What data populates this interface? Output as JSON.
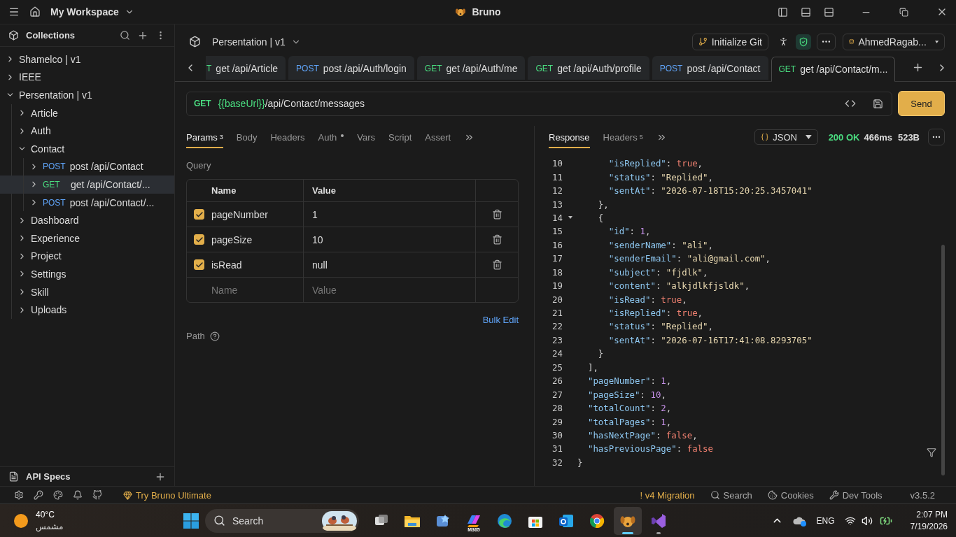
{
  "titlebar": {
    "workspace": "My Workspace",
    "app_title": "Bruno"
  },
  "sidebar": {
    "title": "Collections",
    "tree": [
      {
        "label": "Shamelco | v1",
        "expanded": false,
        "selected": false
      },
      {
        "label": "IEEE",
        "expanded": false,
        "selected": false
      },
      {
        "label": "Persentation | v1",
        "expanded": true,
        "selected": false,
        "children": [
          {
            "label": "Article",
            "expanded": false,
            "selected": false
          },
          {
            "label": "Auth",
            "expanded": false,
            "selected": false
          },
          {
            "label": "Contact",
            "expanded": true,
            "selected": false,
            "children": [
              {
                "method": "POST",
                "kind": "post",
                "label": "post /api/Contact",
                "expanded": false,
                "selected": false
              },
              {
                "method": "GET",
                "kind": "get",
                "label": "get /api/Contact/...",
                "expanded": false,
                "selected": true
              },
              {
                "method": "POST",
                "kind": "post",
                "label": "post /api/Contact/...",
                "expanded": false,
                "selected": false
              }
            ]
          },
          {
            "label": "Dashboard",
            "expanded": false,
            "selected": false
          },
          {
            "label": "Experience",
            "expanded": false,
            "selected": false
          },
          {
            "label": "Project",
            "expanded": false,
            "selected": false
          },
          {
            "label": "Settings",
            "expanded": false,
            "selected": false
          },
          {
            "label": "Skill",
            "expanded": false,
            "selected": false
          },
          {
            "label": "Uploads",
            "expanded": false,
            "selected": false
          }
        ]
      }
    ],
    "footer": "API Specs"
  },
  "collection_header": {
    "title": "Persentation | v1",
    "git_button": "Initialize Git",
    "environment": "AhmedRagab..."
  },
  "request_tabs": [
    {
      "method": "T",
      "kind": "get",
      "label": "get /api/Article",
      "selected": false
    },
    {
      "method": "POST",
      "kind": "post",
      "label": "post /api/Auth/login",
      "selected": false
    },
    {
      "method": "GET",
      "kind": "get",
      "label": "get /api/Auth/me",
      "selected": false
    },
    {
      "method": "GET",
      "kind": "get",
      "label": "get /api/Auth/profile",
      "selected": false
    },
    {
      "method": "POST",
      "kind": "post",
      "label": "post /api/Contact",
      "selected": false
    },
    {
      "method": "GET",
      "kind": "get",
      "label": "get /api/Contact/m...",
      "selected": true
    }
  ],
  "url_bar": {
    "method": "GET",
    "variable": "{{baseUrl}}",
    "path": "/api/Contact/messages",
    "send": "Send"
  },
  "request_pane": {
    "tabs": [
      {
        "label": "Params",
        "count": "3",
        "dot": false,
        "selected": true
      },
      {
        "label": "Body",
        "dot": false,
        "selected": false
      },
      {
        "label": "Headers",
        "dot": false,
        "selected": false
      },
      {
        "label": "Auth",
        "dot": true,
        "selected": false
      },
      {
        "label": "Vars",
        "dot": false,
        "selected": false
      },
      {
        "label": "Script",
        "dot": false,
        "selected": false
      },
      {
        "label": "Assert",
        "dot": false,
        "selected": false
      }
    ],
    "section": "Query",
    "columns": [
      "Name",
      "Value"
    ],
    "params": [
      {
        "name": "pageNumber",
        "value": "1",
        "checked": true
      },
      {
        "name": "pageSize",
        "value": "10",
        "checked": true
      },
      {
        "name": "isRead",
        "value": "null",
        "checked": true
      }
    ],
    "new_row": {
      "name_placeholder": "Name",
      "value_placeholder": "Value"
    },
    "bulk_edit": "Bulk Edit",
    "path_label": "Path"
  },
  "response_pane": {
    "tabs": [
      {
        "label": "Response",
        "selected": true
      },
      {
        "label": "Headers",
        "count": "5",
        "selected": false
      }
    ],
    "format": "JSON",
    "status": "200 OK",
    "time": "466ms",
    "size": "523B",
    "lines": [
      {
        "number": "10",
        "foldable": false,
        "tokens": [
          {
            "kind": "key",
            "text": "      \"isReplied\""
          },
          {
            "kind": "punct",
            "text": ": "
          },
          {
            "kind": "bool",
            "text": "true"
          },
          {
            "kind": "punct",
            "text": ","
          }
        ]
      },
      {
        "number": "11",
        "foldable": false,
        "tokens": [
          {
            "kind": "key",
            "text": "      \"status\""
          },
          {
            "kind": "punct",
            "text": ": "
          },
          {
            "kind": "string",
            "text": "\"Replied\""
          },
          {
            "kind": "punct",
            "text": ","
          }
        ]
      },
      {
        "number": "12",
        "foldable": false,
        "tokens": [
          {
            "kind": "key",
            "text": "      \"sentAt\""
          },
          {
            "kind": "punct",
            "text": ": "
          },
          {
            "kind": "string",
            "text": "\"2026-07-18T15:20:25.3457041\""
          }
        ]
      },
      {
        "number": "13",
        "foldable": false,
        "tokens": [
          {
            "kind": "punct",
            "text": "    },"
          }
        ]
      },
      {
        "number": "14",
        "foldable": true,
        "tokens": [
          {
            "kind": "punct",
            "text": "    {"
          }
        ]
      },
      {
        "number": "15",
        "foldable": false,
        "tokens": [
          {
            "kind": "key",
            "text": "      \"id\""
          },
          {
            "kind": "punct",
            "text": ": "
          },
          {
            "kind": "number",
            "text": "1"
          },
          {
            "kind": "punct",
            "text": ","
          }
        ]
      },
      {
        "number": "16",
        "foldable": false,
        "tokens": [
          {
            "kind": "key",
            "text": "      \"senderName\""
          },
          {
            "kind": "punct",
            "text": ": "
          },
          {
            "kind": "string",
            "text": "\"ali\""
          },
          {
            "kind": "punct",
            "text": ","
          }
        ]
      },
      {
        "number": "17",
        "foldable": false,
        "tokens": [
          {
            "kind": "key",
            "text": "      \"senderEmail\""
          },
          {
            "kind": "punct",
            "text": ": "
          },
          {
            "kind": "string",
            "text": "\"ali@gmail.com\""
          },
          {
            "kind": "punct",
            "text": ","
          }
        ]
      },
      {
        "number": "18",
        "foldable": false,
        "tokens": [
          {
            "kind": "key",
            "text": "      \"subject\""
          },
          {
            "kind": "punct",
            "text": ": "
          },
          {
            "kind": "string",
            "text": "\"fjdlk\""
          },
          {
            "kind": "punct",
            "text": ","
          }
        ]
      },
      {
        "number": "19",
        "foldable": false,
        "tokens": [
          {
            "kind": "key",
            "text": "      \"content\""
          },
          {
            "kind": "punct",
            "text": ": "
          },
          {
            "kind": "string",
            "text": "\"alkjdlkfjsldk\""
          },
          {
            "kind": "punct",
            "text": ","
          }
        ]
      },
      {
        "number": "20",
        "foldable": false,
        "tokens": [
          {
            "kind": "key",
            "text": "      \"isRead\""
          },
          {
            "kind": "punct",
            "text": ": "
          },
          {
            "kind": "bool",
            "text": "true"
          },
          {
            "kind": "punct",
            "text": ","
          }
        ]
      },
      {
        "number": "21",
        "foldable": false,
        "tokens": [
          {
            "kind": "key",
            "text": "      \"isReplied\""
          },
          {
            "kind": "punct",
            "text": ": "
          },
          {
            "kind": "bool",
            "text": "true"
          },
          {
            "kind": "punct",
            "text": ","
          }
        ]
      },
      {
        "number": "22",
        "foldable": false,
        "tokens": [
          {
            "kind": "key",
            "text": "      \"status\""
          },
          {
            "kind": "punct",
            "text": ": "
          },
          {
            "kind": "string",
            "text": "\"Replied\""
          },
          {
            "kind": "punct",
            "text": ","
          }
        ]
      },
      {
        "number": "23",
        "foldable": false,
        "tokens": [
          {
            "kind": "key",
            "text": "      \"sentAt\""
          },
          {
            "kind": "punct",
            "text": ": "
          },
          {
            "kind": "string",
            "text": "\"2026-07-16T17:41:08.8293705\""
          }
        ]
      },
      {
        "number": "24",
        "foldable": false,
        "tokens": [
          {
            "kind": "punct",
            "text": "    }"
          }
        ]
      },
      {
        "number": "25",
        "foldable": false,
        "tokens": [
          {
            "kind": "punct",
            "text": "  ],"
          }
        ]
      },
      {
        "number": "26",
        "foldable": false,
        "tokens": [
          {
            "kind": "key",
            "text": "  \"pageNumber\""
          },
          {
            "kind": "punct",
            "text": ": "
          },
          {
            "kind": "number",
            "text": "1"
          },
          {
            "kind": "punct",
            "text": ","
          }
        ]
      },
      {
        "number": "27",
        "foldable": false,
        "tokens": [
          {
            "kind": "key",
            "text": "  \"pageSize\""
          },
          {
            "kind": "punct",
            "text": ": "
          },
          {
            "kind": "number",
            "text": "10"
          },
          {
            "kind": "punct",
            "text": ","
          }
        ]
      },
      {
        "number": "28",
        "foldable": false,
        "tokens": [
          {
            "kind": "key",
            "text": "  \"totalCount\""
          },
          {
            "kind": "punct",
            "text": ": "
          },
          {
            "kind": "number",
            "text": "2"
          },
          {
            "kind": "punct",
            "text": ","
          }
        ]
      },
      {
        "number": "29",
        "foldable": false,
        "tokens": [
          {
            "kind": "key",
            "text": "  \"totalPages\""
          },
          {
            "kind": "punct",
            "text": ": "
          },
          {
            "kind": "number",
            "text": "1"
          },
          {
            "kind": "punct",
            "text": ","
          }
        ]
      },
      {
        "number": "30",
        "foldable": false,
        "tokens": [
          {
            "kind": "key",
            "text": "  \"hasNextPage\""
          },
          {
            "kind": "punct",
            "text": ": "
          },
          {
            "kind": "bool",
            "text": "false"
          },
          {
            "kind": "punct",
            "text": ","
          }
        ]
      },
      {
        "number": "31",
        "foldable": false,
        "tokens": [
          {
            "kind": "key",
            "text": "  \"hasPreviousPage\""
          },
          {
            "kind": "punct",
            "text": ": "
          },
          {
            "kind": "bool",
            "text": "false"
          }
        ]
      },
      {
        "number": "32",
        "foldable": false,
        "tokens": [
          {
            "kind": "punct",
            "text": "}"
          }
        ]
      }
    ]
  },
  "status_bar": {
    "promo": "Try Bruno Ultimate",
    "migration": "! v4 Migration",
    "search": "Search",
    "cookies": "Cookies",
    "dev_tools": "Dev Tools",
    "version": "v3.5.2"
  },
  "taskbar": {
    "temperature": "40°C",
    "weather": "مشمس",
    "search": "Search",
    "apps": [
      {
        "kind": "taskview",
        "active": false
      },
      {
        "kind": "explorer",
        "active": false
      },
      {
        "kind": "widgets",
        "active": false
      },
      {
        "kind": "m365",
        "label": "M365",
        "active": false
      },
      {
        "kind": "edge",
        "active": false
      },
      {
        "kind": "store",
        "active": false
      },
      {
        "kind": "outlook",
        "active": false
      },
      {
        "kind": "chrome",
        "active": false
      },
      {
        "kind": "bruno",
        "active": true
      },
      {
        "kind": "studio",
        "active": false
      }
    ],
    "language": "ENG",
    "time": "2:07 PM",
    "date": "7/19/2026"
  }
}
